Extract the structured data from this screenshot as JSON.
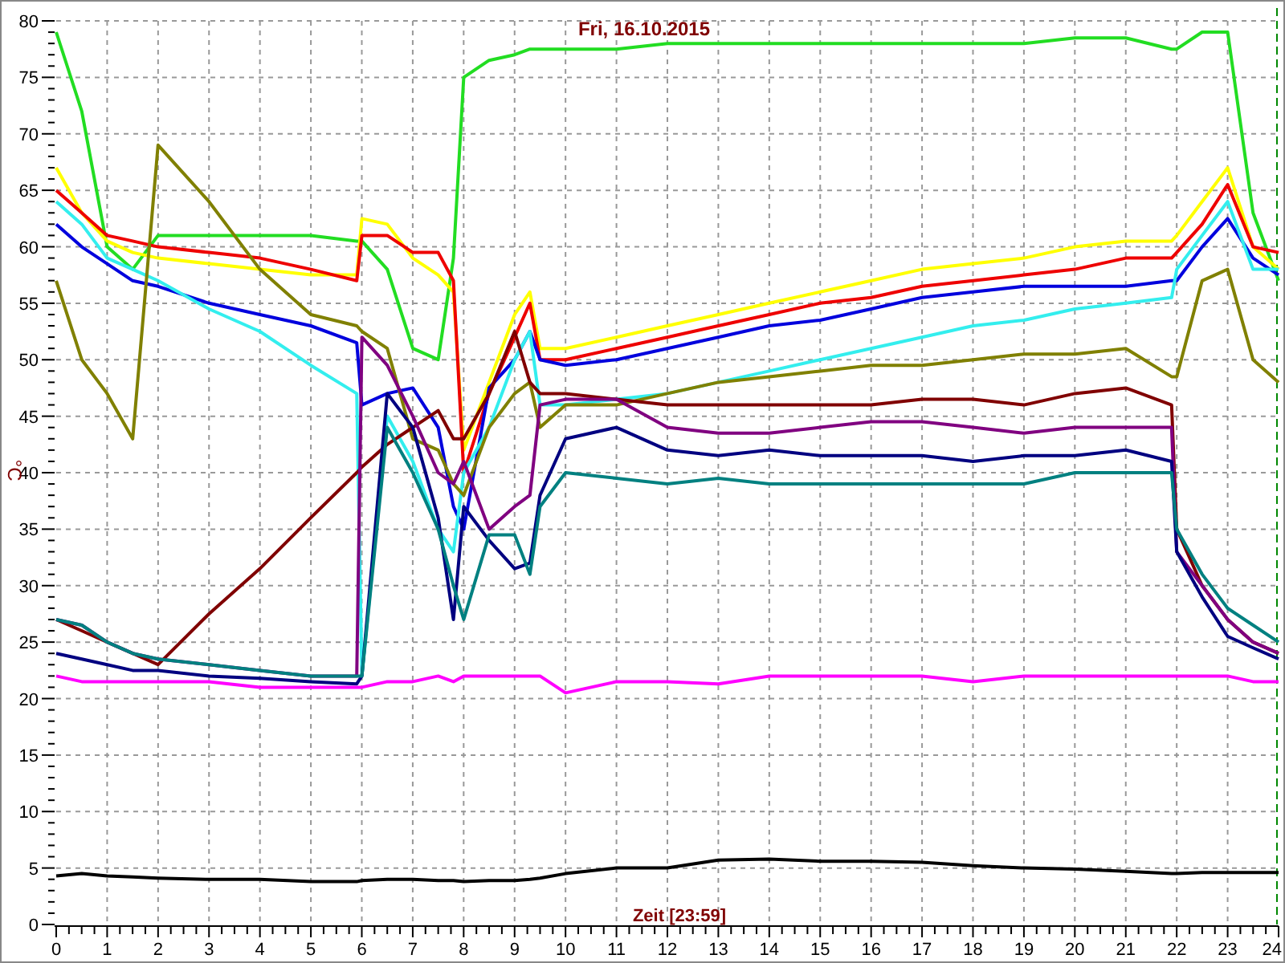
{
  "chart_data": {
    "type": "line",
    "title": "Fri, 16.10.2015",
    "xlabel": "Zeit [23:59]",
    "ylabel": "°C",
    "x": [
      0,
      0.5,
      1,
      1.5,
      2,
      3,
      4,
      5,
      5.9,
      6,
      6.5,
      7,
      7.5,
      7.8,
      8,
      8.5,
      9,
      9.3,
      9.5,
      10,
      11,
      12,
      13,
      14,
      15,
      16,
      17,
      18,
      19,
      20,
      21,
      21.9,
      22,
      22.5,
      23,
      23.5,
      24
    ],
    "xlim": [
      0,
      24
    ],
    "ylim": [
      0,
      80
    ],
    "xticks": [
      0,
      1,
      2,
      3,
      4,
      5,
      6,
      7,
      8,
      9,
      10,
      11,
      12,
      13,
      14,
      15,
      16,
      17,
      18,
      19,
      20,
      21,
      22,
      23,
      24
    ],
    "yticks": [
      0,
      5,
      10,
      15,
      20,
      25,
      30,
      35,
      40,
      45,
      50,
      55,
      60,
      65,
      70,
      75,
      80
    ],
    "series": [
      {
        "color": "#22dd22",
        "values": [
          79,
          72,
          60,
          58,
          61,
          61,
          61,
          61,
          60.5,
          60.5,
          58,
          51,
          50,
          59,
          75,
          76.5,
          77,
          77.5,
          77.5,
          77.5,
          77.5,
          78,
          78,
          78,
          78,
          78,
          78,
          78,
          78,
          78.5,
          78.5,
          77.5,
          77.5,
          79,
          79,
          63,
          57
        ]
      },
      {
        "color": "#ffff00",
        "values": [
          67,
          63,
          60.5,
          59.5,
          59,
          58.5,
          58,
          57.5,
          57.5,
          62.5,
          62,
          59,
          57.5,
          56,
          42,
          48,
          54,
          56,
          51,
          51,
          52,
          53,
          54,
          55,
          56,
          57,
          58,
          58.5,
          59,
          60,
          60.5,
          60.5,
          61,
          64,
          67,
          60,
          58
        ]
      },
      {
        "color": "#ee0000",
        "values": [
          65,
          63,
          61,
          60.5,
          60,
          59.5,
          59,
          58,
          57,
          61,
          61,
          59.5,
          59.5,
          57,
          40,
          47,
          52,
          55,
          50,
          50,
          51,
          52,
          53,
          54,
          55,
          55.5,
          56.5,
          57,
          57.5,
          58,
          59,
          59,
          59.5,
          62,
          65.5,
          60,
          59.5
        ]
      },
      {
        "color": "#0000dd",
        "values": [
          62,
          60,
          58.5,
          57,
          56.5,
          55,
          54,
          53,
          51.5,
          46,
          47,
          47.5,
          44,
          37,
          35,
          47.5,
          50,
          52.5,
          50,
          49.5,
          50,
          51,
          52,
          53,
          53.5,
          54.5,
          55.5,
          56,
          56.5,
          56.5,
          56.5,
          57,
          57,
          60,
          62.5,
          59,
          57.5
        ]
      },
      {
        "color": "#33eeee",
        "values": [
          64,
          62,
          59,
          58,
          57,
          54.5,
          52.5,
          49.5,
          47,
          22,
          45,
          41,
          35,
          33,
          40,
          44,
          50,
          52.5,
          46,
          46,
          46.5,
          47,
          48,
          49,
          50,
          51,
          52,
          53,
          53.5,
          54.5,
          55,
          55.5,
          58,
          61,
          64,
          58,
          58
        ]
      },
      {
        "color": "#808000",
        "values": [
          57,
          50,
          47,
          43,
          69,
          64,
          58,
          54,
          53,
          52.5,
          51,
          43,
          42,
          39,
          38,
          44,
          47,
          48,
          44,
          46,
          46,
          47,
          48,
          48.5,
          49,
          49.5,
          49.5,
          50,
          50.5,
          50.5,
          51,
          48.5,
          48.5,
          57,
          58,
          50,
          48
        ]
      },
      {
        "color": "#800000",
        "values": [
          27,
          26,
          25,
          24,
          23,
          27.5,
          31.5,
          36,
          40,
          40.5,
          42.5,
          44,
          45.5,
          43,
          43,
          47,
          52.5,
          48,
          47,
          47,
          46.5,
          46,
          46,
          46,
          46,
          46,
          46.5,
          46.5,
          46,
          47,
          47.5,
          46,
          35,
          30,
          27,
          25,
          24
        ]
      },
      {
        "color": "#800080",
        "values": [
          27,
          26.5,
          25,
          24,
          23.5,
          23,
          22.5,
          22,
          22,
          52,
          49.5,
          45,
          40,
          39,
          41,
          35,
          37,
          38,
          46,
          46.5,
          46.5,
          44,
          43.5,
          43.5,
          44,
          44.5,
          44.5,
          44,
          43.5,
          44,
          44,
          44,
          33,
          30,
          27,
          25,
          24
        ]
      },
      {
        "color": "#000080",
        "values": [
          24,
          23.5,
          23,
          22.5,
          22.5,
          22,
          21.8,
          21.5,
          21.3,
          22,
          47,
          44,
          36,
          27,
          37,
          34,
          31.5,
          32,
          38,
          43,
          44,
          42,
          41.5,
          42,
          41.5,
          41.5,
          41.5,
          41,
          41.5,
          41.5,
          42,
          41,
          33,
          29,
          25.5,
          24.5,
          23.5
        ]
      },
      {
        "color": "#008080",
        "values": [
          27,
          26.5,
          25,
          24,
          23.5,
          23,
          22.5,
          22,
          22,
          22,
          44,
          40,
          35,
          30,
          27,
          34.5,
          34.5,
          31,
          37,
          40,
          39.5,
          39,
          39.5,
          39,
          39,
          39,
          39,
          39,
          39,
          40,
          40,
          40,
          35,
          31,
          28,
          26.5,
          25
        ]
      },
      {
        "color": "#ff00ff",
        "values": [
          22,
          21.5,
          21.5,
          21.5,
          21.5,
          21.5,
          21,
          21,
          21,
          21,
          21.5,
          21.5,
          22,
          21.5,
          22,
          22,
          22,
          22,
          22,
          20.5,
          21.5,
          21.5,
          21.3,
          22,
          22,
          22,
          22,
          21.5,
          22,
          22,
          22,
          22,
          22,
          22,
          22,
          21.5,
          21.5
        ]
      },
      {
        "color": "#000000",
        "values": [
          4.3,
          4.5,
          4.3,
          4.2,
          4.1,
          4,
          4,
          3.8,
          3.8,
          3.9,
          4,
          4,
          3.9,
          3.9,
          3.8,
          3.9,
          3.9,
          4,
          4.1,
          4.5,
          5,
          5,
          5.7,
          5.8,
          5.6,
          5.6,
          5.5,
          5.2,
          5,
          4.9,
          4.7,
          4.5,
          4.5,
          4.6,
          4.6,
          4.6,
          4.6
        ]
      }
    ],
    "grid": true
  }
}
